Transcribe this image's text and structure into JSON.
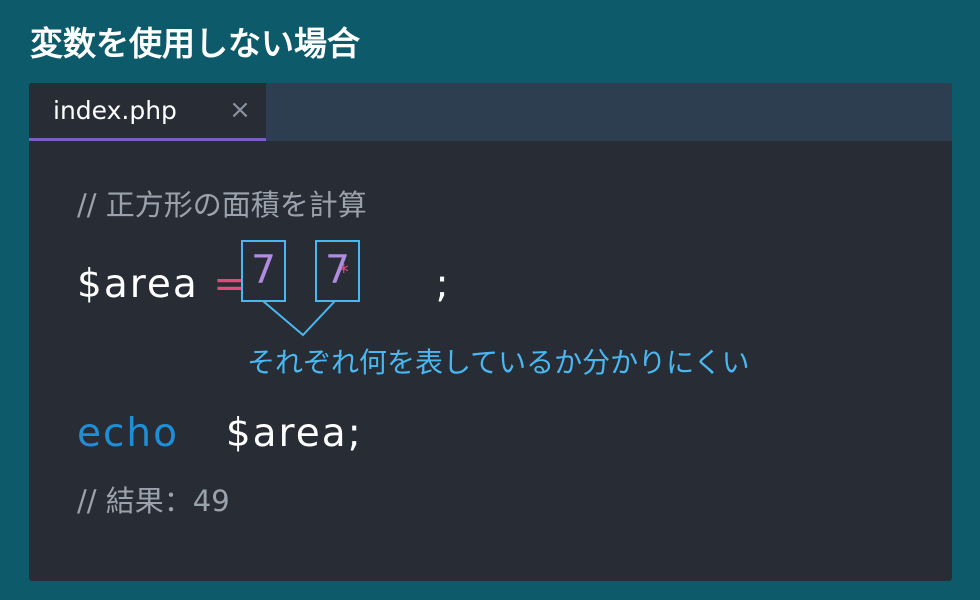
{
  "page": {
    "title": "変数を使用しない場合"
  },
  "tab": {
    "label": "index.php",
    "close_glyph": "×"
  },
  "code": {
    "comment1": "// 正方形の面積を計算",
    "line2_var": "$area",
    "line2_eq": "=",
    "line2_num1": "7",
    "line2_mul": "*",
    "line2_num2": "7",
    "line2_semi": ";",
    "line3_echo": "echo",
    "line3_rest": "$area;",
    "comment2": "// 結果：49"
  },
  "annotation": {
    "text": "それぞれ何を表しているか分かりにくい"
  },
  "colors": {
    "background": "#0d5a6a",
    "editor": "#282c34",
    "tabbar": "#2c3e50",
    "tab_accent": "#7c5cc7",
    "comment": "#9aa3ad",
    "operator": "#e24a7a",
    "number": "#b08be0",
    "keyword": "#1e8fd6",
    "annotation": "#49b8f2"
  }
}
